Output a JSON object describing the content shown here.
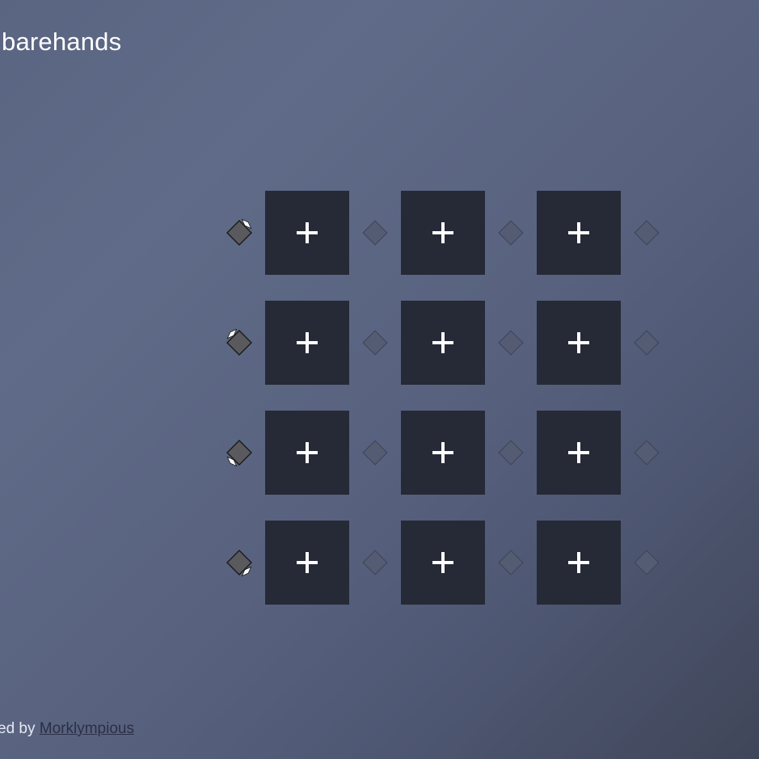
{
  "header": {
    "title": "barehands"
  },
  "footer": {
    "prefix": "ed by ",
    "link_text": "Morklympious"
  },
  "grid": {
    "rows": [
      {
        "direction_icon": "rotation-arrow-up-right-icon",
        "slots": [
          "add-slot",
          "add-slot",
          "add-slot"
        ]
      },
      {
        "direction_icon": "rotation-arrow-up-left-icon",
        "slots": [
          "add-slot",
          "add-slot",
          "add-slot"
        ]
      },
      {
        "direction_icon": "rotation-arrow-down-left-icon",
        "slots": [
          "add-slot",
          "add-slot",
          "add-slot"
        ]
      },
      {
        "direction_icon": "rotation-arrow-down-right-icon",
        "slots": [
          "add-slot",
          "add-slot",
          "add-slot"
        ]
      }
    ]
  },
  "colors": {
    "slot_background": "#262a37",
    "connector": "#545c73",
    "direction_icon_fill": "#5a5a5e",
    "footer_link": "#2a2f45"
  }
}
